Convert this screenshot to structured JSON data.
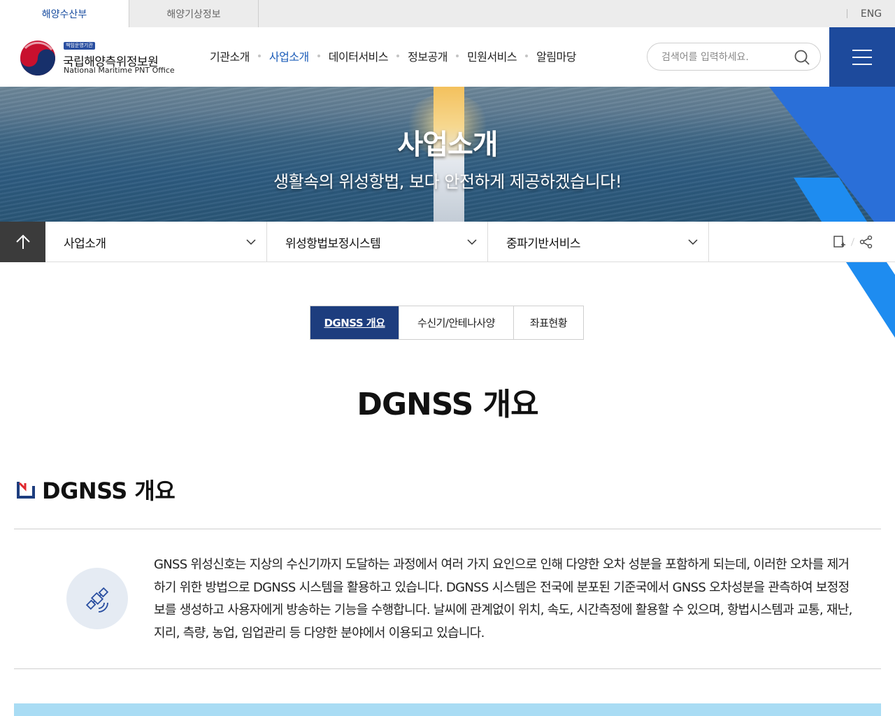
{
  "top_tabs": [
    {
      "label": "해양수산부",
      "active": true
    },
    {
      "label": "해양기상정보",
      "active": false
    }
  ],
  "lang_link": "ENG",
  "logo": {
    "badge": "책임운영기관",
    "name_ko": "국립해양측위정보원",
    "name_en": "National Maritime PNT Office"
  },
  "gnb": {
    "items": [
      "기관소개",
      "사업소개",
      "데이터서비스",
      "정보공개",
      "민원서비스",
      "알림마당"
    ],
    "active_index": 1
  },
  "search": {
    "placeholder": "검색어를 입력하세요.",
    "icon": "search-icon"
  },
  "menu_icon": "hamburger-icon",
  "hero": {
    "title": "사업소개",
    "subtitle": "생활속의 위성항법, 보다 안전하게 제공하겠습니다!"
  },
  "location": {
    "home_icon": "home-icon",
    "selects": [
      "사업소개",
      "위성항법보정시스템",
      "중파기반서비스"
    ],
    "tools": [
      "print-icon",
      "share-icon"
    ]
  },
  "sub_tabs": [
    {
      "label": "DGNSS 개요",
      "active": true
    },
    {
      "label": "수신기/안테나사양",
      "active": false
    },
    {
      "label": "좌표현황",
      "active": false
    }
  ],
  "page_title": "DGNSS 개요",
  "section": {
    "title": "DGNSS 개요",
    "icon": "satellite-icon",
    "description": "GNSS 위성신호는 지상의 수신기까지 도달하는 과정에서 여러 가지 요인으로 인해 다양한 오차 성분을 포함하게 되는데, 이러한 오차를 제거하기 위한 방법으로 DGNSS 시스템을 활용하고 있습니다. DGNSS 시스템은 전국에 분포된 기준국에서 GNSS 오차성분을 관측하여 보정정보를 생성하고 사용자에게 방송하는 기능을 수행합니다. 날씨에 관계없이 위치, 속도, 시간측정에 활용할 수 있으며, 항법시스템과 교통, 재난, 지리, 측량, 농업, 임업관리 등 다양한 분야에서 이용되고 있습니다."
  },
  "colors": {
    "primary": "#1d4a9c",
    "active_tab": "#1d3d7e",
    "accent_blue": "#1a5bb8",
    "light_band": "#a9dcf4"
  }
}
